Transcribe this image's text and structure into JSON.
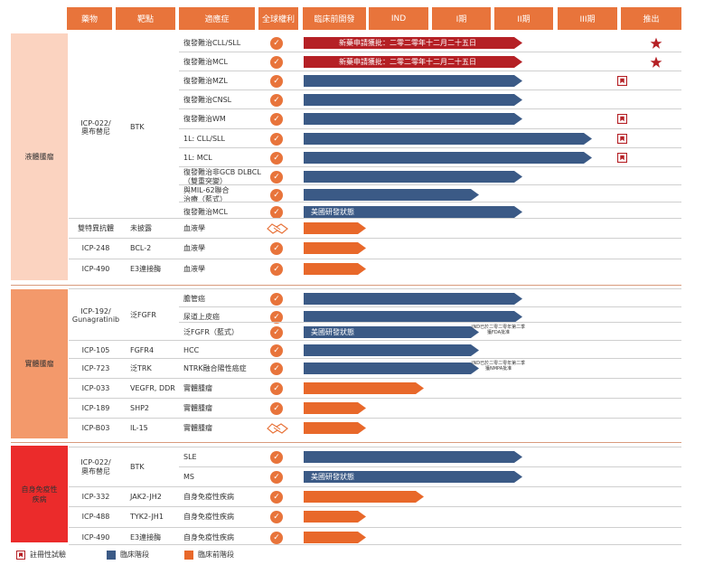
{
  "headers": [
    "藥物",
    "靶點",
    "適應症",
    "全球權利",
    "臨床前開發",
    "IND",
    "I期",
    "II期",
    "III期",
    "推出"
  ],
  "categories": [
    {
      "label": "液體腫瘤",
      "color": "#fbd3c0"
    },
    {
      "label": "實體腫瘤",
      "color": "#f3996b"
    },
    {
      "label": "自身免疫性\n疾病",
      "color": "#eb2b2b"
    }
  ],
  "rows": [
    {
      "drug": "ICP-022/\n奧布替尼",
      "target": "BTK",
      "ind": "復發難治CLL/SLL",
      "rights": "check",
      "phase": "II期",
      "bar": "red",
      "label": "新藥申請獲批：二零二零年十二月二十五日",
      "marker": "star"
    },
    {
      "drug": "",
      "target": "",
      "ind": "復發難治MCL",
      "rights": "check",
      "phase": "II期",
      "bar": "red",
      "label": "新藥申請獲批：二零二零年十二月二十五日",
      "marker": "star"
    },
    {
      "drug": "",
      "target": "",
      "ind": "復發難治MZL",
      "rights": "check",
      "phase": "II期",
      "bar": "blue",
      "label": "",
      "marker": "reg"
    },
    {
      "drug": "",
      "target": "",
      "ind": "復發難治CNSL",
      "rights": "check",
      "phase": "II期",
      "bar": "blue",
      "label": "",
      "marker": ""
    },
    {
      "drug": "",
      "target": "",
      "ind": "復發難治WM",
      "rights": "check",
      "phase": "II期",
      "bar": "blue",
      "label": "",
      "marker": "reg"
    },
    {
      "drug": "",
      "target": "",
      "ind": "1L: CLL/SLL",
      "rights": "check",
      "phase": "III期",
      "bar": "blue",
      "label": "",
      "marker": "reg"
    },
    {
      "drug": "",
      "target": "",
      "ind": "1L: MCL",
      "rights": "check",
      "phase": "III期",
      "bar": "blue",
      "label": "",
      "marker": "reg"
    },
    {
      "drug": "",
      "target": "",
      "ind": "復發難治非GCB DLBCL\n（雙重突變）",
      "rights": "check",
      "phase": "II期",
      "bar": "blue",
      "label": "",
      "marker": ""
    },
    {
      "drug": "",
      "target": "",
      "ind": "與MIL-62聯合\n治療（藍式）",
      "rights": "check",
      "phase": "I期",
      "bar": "blue",
      "label": "",
      "marker": ""
    },
    {
      "drug": "",
      "target": "",
      "ind": "復發難治MCL",
      "rights": "check",
      "phase": "II期",
      "bar": "blue",
      "label": "美國研發狀態",
      "marker": ""
    },
    {
      "drug": "雙特異抗體",
      "target": "未披露",
      "ind": "血液學",
      "rights": "handshake",
      "phase": "臨床前開發",
      "bar": "orange",
      "label": "",
      "marker": ""
    },
    {
      "drug": "ICP-248",
      "target": "BCL-2",
      "ind": "血液學",
      "rights": "check",
      "phase": "臨床前開發",
      "bar": "orange",
      "label": "",
      "marker": ""
    },
    {
      "drug": "ICP-490",
      "target": "E3連接酶",
      "ind": "血液學",
      "rights": "check",
      "phase": "臨床前開發",
      "bar": "orange",
      "label": "",
      "marker": ""
    },
    {
      "drug": "ICP-192/\nGunagratinib",
      "target": "泛FGFR",
      "ind": "膽管癌",
      "rights": "check",
      "phase": "II期",
      "bar": "blue",
      "label": "",
      "marker": ""
    },
    {
      "drug": "",
      "target": "",
      "ind": "尿道上皮癌",
      "rights": "check",
      "phase": "II期",
      "bar": "blue",
      "label": "",
      "marker": ""
    },
    {
      "drug": "",
      "target": "",
      "ind": "泛FGFR（藍式）",
      "rights": "check",
      "phase": "I期",
      "bar": "blue",
      "label": "美國研發狀態",
      "marker": "",
      "note": "IND已於二零二零年第二季\n獲FDA批准"
    },
    {
      "drug": "ICP-105",
      "target": "FGFR4",
      "ind": "HCC",
      "rights": "check",
      "phase": "I期",
      "bar": "blue",
      "label": "",
      "marker": ""
    },
    {
      "drug": "ICP-723",
      "target": "泛TRK",
      "ind": "NTRK融合陽性癌症",
      "rights": "check",
      "phase": "I期",
      "bar": "blue",
      "label": "",
      "marker": "",
      "note": "IND已於二零二零年第二季\n獲NMPA批准"
    },
    {
      "drug": "ICP-033",
      "target": "VEGFR, DDR",
      "ind": "實體腫瘤",
      "rights": "check",
      "phase": "IND",
      "bar": "orange",
      "label": "",
      "marker": ""
    },
    {
      "drug": "ICP-189",
      "target": "SHP2",
      "ind": "實體腫瘤",
      "rights": "check",
      "phase": "臨床前開發",
      "bar": "orange",
      "label": "",
      "marker": ""
    },
    {
      "drug": "ICP-B03",
      "target": "IL-15",
      "ind": "實體腫瘤",
      "rights": "handshake",
      "phase": "臨床前開發",
      "bar": "orange",
      "label": "",
      "marker": ""
    },
    {
      "drug": "ICP-022/\n奧布替尼",
      "target": "BTK",
      "ind": "SLE",
      "rights": "check",
      "phase": "II期",
      "bar": "blue",
      "label": "",
      "marker": ""
    },
    {
      "drug": "",
      "target": "",
      "ind": "MS",
      "rights": "check",
      "phase": "II期",
      "bar": "blue",
      "label": "美國研發狀態",
      "marker": ""
    },
    {
      "drug": "ICP-332",
      "target": "JAK2-JH2",
      "ind": "自身免疫性疾病",
      "rights": "check",
      "phase": "IND",
      "bar": "orange",
      "label": "",
      "marker": ""
    },
    {
      "drug": "ICP-488",
      "target": "TYK2-JH1",
      "ind": "自身免疫性疾病",
      "rights": "check",
      "phase": "臨床前開發",
      "bar": "orange",
      "label": "",
      "marker": ""
    },
    {
      "drug": "ICP-490",
      "target": "E3連接酶",
      "ind": "自身免疫性疾病",
      "rights": "check",
      "phase": "臨床前開發",
      "bar": "orange",
      "label": "",
      "marker": ""
    }
  ],
  "legend": {
    "registrational": "註冊性試驗",
    "clinical": "臨床階段",
    "preclinical": "臨床前階段"
  },
  "colors": {
    "header": "#e8743b",
    "blue": "#3b5a86",
    "orange": "#e8682a",
    "red": "#b52025",
    "check": "#e8743b"
  }
}
